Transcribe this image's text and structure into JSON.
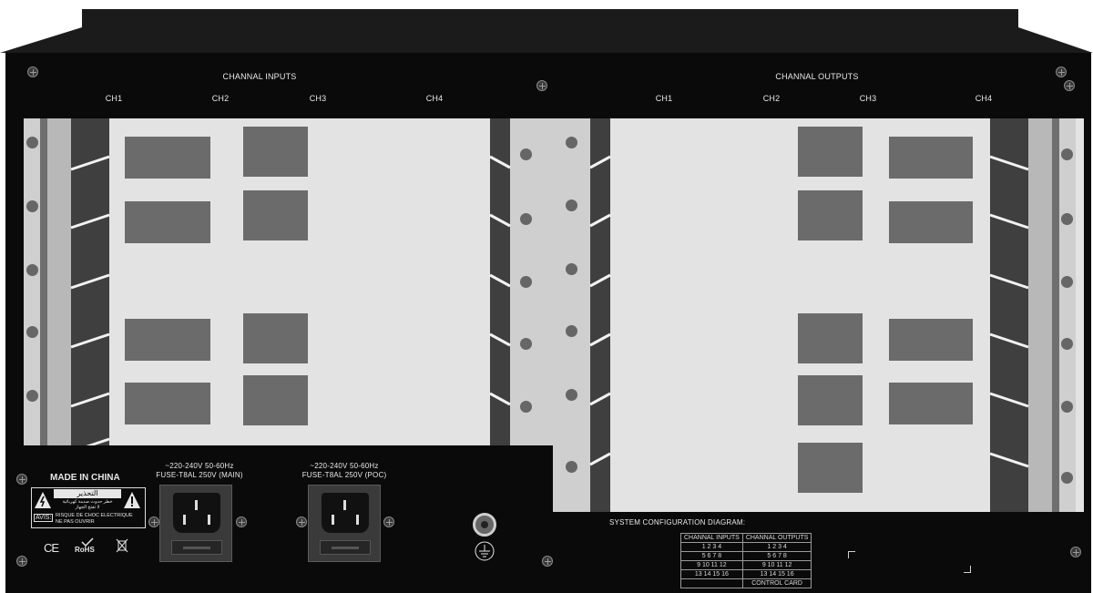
{
  "inputs": {
    "title": "CHANNAL INPUTS",
    "channels": [
      "CH1",
      "CH2",
      "CH3",
      "CH4"
    ]
  },
  "outputs": {
    "title": "CHANNAL OUTPUTS",
    "channels": [
      "CH1",
      "CH2",
      "CH3",
      "CH4"
    ]
  },
  "power": {
    "made_in": "MADE IN CHINA",
    "main_line1": "~220-240V  50-60Hz",
    "main_line2": "FUSE-T8AL 250V (MAIN)",
    "poc_line1": "~220-240V  50-60Hz",
    "poc_line2": "FUSE-T8AL 250V (POC)"
  },
  "warning": {
    "arabic_title": "التحذير",
    "arabic_text_1": "خطر حدوث صدمة كهربائية",
    "arabic_text_2": "لا تفتح الجهاز",
    "avis": "AVIS:",
    "french_1": "RISQUE DE CHOC ELECTRIQUE",
    "french_2": "NE PAS OUVRIR"
  },
  "marks": {
    "ce": "CE",
    "rohs": "RoHS"
  },
  "config": {
    "title": "SYSTEM CONFIGURATION DIAGRAM:",
    "inputs_header": "CHANNAL INPUTS",
    "outputs_header": "CHANNAL OUTPUTS",
    "rows": [
      [
        "1   2   3   4",
        "1   2   3   4"
      ],
      [
        "5   6   7   8",
        "5   6   7   8"
      ],
      [
        "9   10   11   12",
        "9   10   11   12"
      ],
      [
        "13   14   15   16",
        "13   14   15   16"
      ]
    ],
    "control_card": "CONTROL CARD"
  },
  "colors": {
    "chassis": "#0a0a0a",
    "panel": "#e3e3e3",
    "cutout": "#6b6b6b",
    "rail": "#b8b8b8"
  }
}
